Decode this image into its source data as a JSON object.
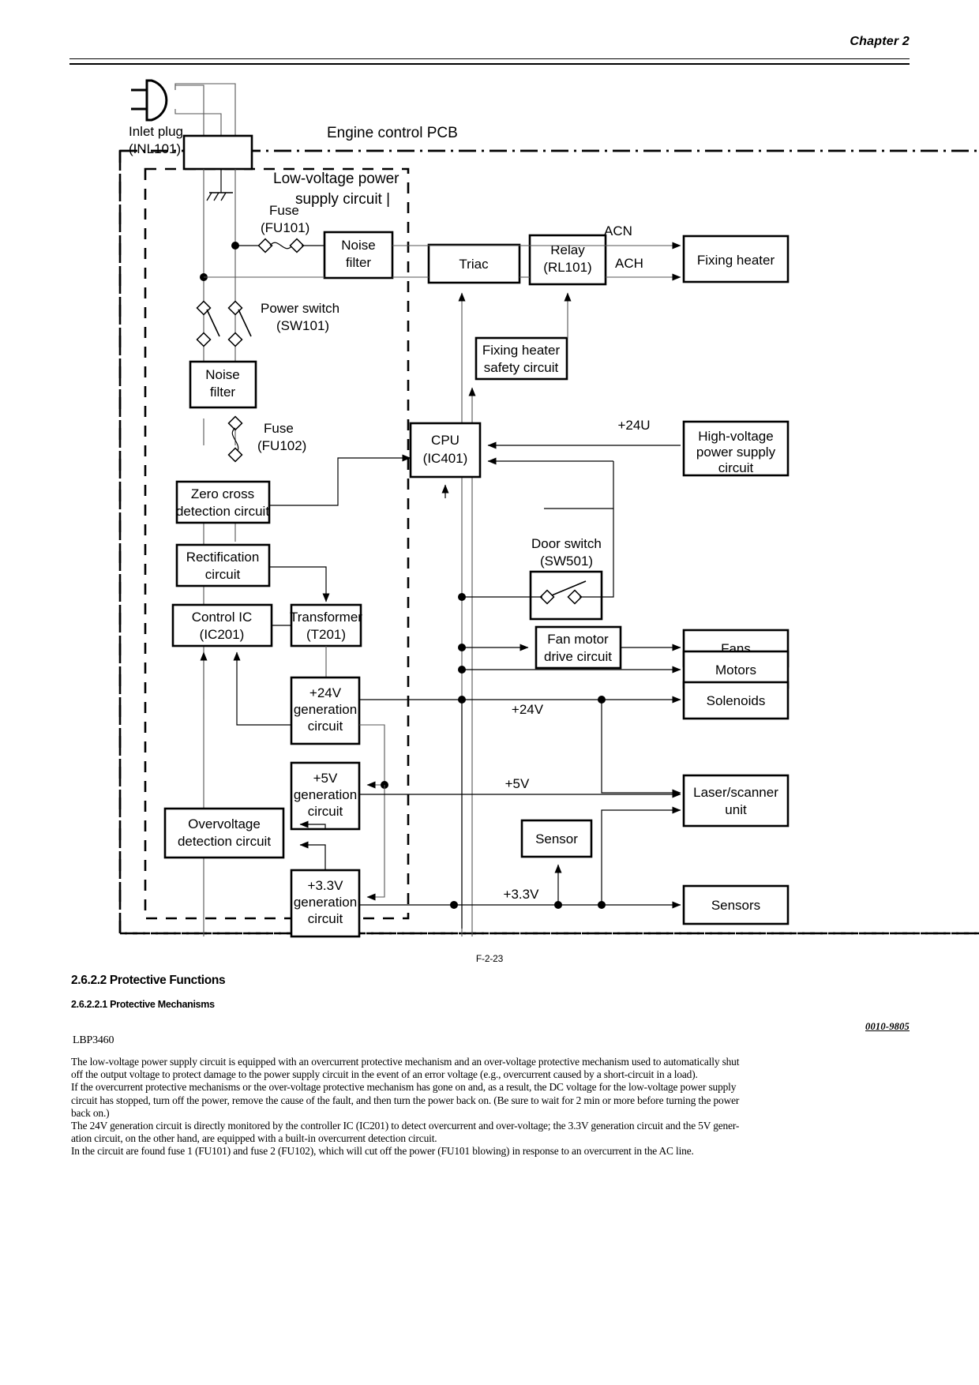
{
  "header": {
    "chapter": "Chapter 2"
  },
  "figure": {
    "caption": "F-2-23",
    "title_engine_pcb": "Engine control PCB",
    "title_lvps_line1": "Low-voltage power",
    "title_lvps_line2": "supply circuit |",
    "inlet_plug_line1": "Inlet plug",
    "inlet_plug_line2": "(INL101)",
    "fuse1_line1": "Fuse",
    "fuse1_line2": "(FU101)",
    "fuse2_line1": "Fuse",
    "fuse2_line2": "(FU102)",
    "power_switch_line1": "Power switch",
    "power_switch_line2": "(SW101)",
    "door_switch_line1": "Door switch",
    "door_switch_line2": "(SW501)",
    "noise_filter_1_line1": "Noise",
    "noise_filter_1_line2": "filter",
    "noise_filter_2_line1": "Noise",
    "noise_filter_2_line2": "filter",
    "triac": "Triac",
    "relay_line1": "Relay",
    "relay_line2": "(RL101)",
    "fixing_heater_safety_line1": "Fixing heater",
    "fixing_heater_safety_line2": "safety circuit",
    "cpu_line1": "CPU",
    "cpu_line2": "(IC401)",
    "zero_cross_line1": "Zero cross",
    "zero_cross_line2": "detection circuit",
    "rectification_line1": "Rectification",
    "rectification_line2": "circuit",
    "control_ic_line1": "Control IC",
    "control_ic_line2": "(IC201)",
    "transformer_line1": "Transformer",
    "transformer_line2": "(T201)",
    "gen24_line1": "+24V",
    "gen24_line2": "generation",
    "gen24_line3": "circuit",
    "gen5_line1": "+5V",
    "gen5_line2": "generation",
    "gen5_line3": "circuit",
    "gen33_line1": "+3.3V",
    "gen33_line2": "generation",
    "gen33_line3": "circuit",
    "overvoltage_line1": "Overvoltage",
    "overvoltage_line2": "detection circuit",
    "fan_motor_line1": "Fan motor",
    "fan_motor_line2": "drive circuit",
    "sensor_box": "Sensor",
    "fixing_heater": "Fixing heater",
    "hv_psu_line1": "High-voltage",
    "hv_psu_line2": "power supply",
    "hv_psu_line3": "circuit",
    "fans": "Fans",
    "motors": "Motors",
    "solenoids": "Solenoids",
    "laser_scanner_line1": "Laser/scanner",
    "laser_scanner_line2": "unit",
    "sensors": "Sensors",
    "signal_acn": "ACN",
    "signal_ach": "ACH",
    "signal_24u": "+24U",
    "signal_24v": "+24V",
    "signal_5v": "+5V",
    "signal_33v": "+3.3V"
  },
  "sections": {
    "heading_2622": "2.6.2.2 Protective Functions",
    "heading_26221": "2.6.2.2.1 Protective Mechanisms"
  },
  "document": {
    "code": "0010-9805",
    "model": "LBP3460"
  },
  "body": {
    "text": "The low-voltage power supply circuit is equipped with an overcurrent protective mechanism and an over-voltage protective mechanism used to automatically shut\noff the output voltage to protect damage to the power supply circuit in the event of an error voltage (e.g., overcurrent caused by a short-circuit in a load).\nIf the overcurrent protective mechanisms or the over-voltage protective mechanism has gone on and, as a result, the DC voltage for the low-voltage power supply\ncircuit has stopped, turn off the power, remove the cause of the fault, and then turn the power back on. (Be sure to wait for 2 min or more before turning the power\nback on.)\nThe 24V generation circuit is directly monitored by the controller IC (IC201) to detect overcurrent and over-voltage; the 3.3V generation circuit and the 5V gener-\nation circuit, on the other hand, are equipped with a built-in overcurrent detection circuit.\nIn the circuit are found fuse 1 (FU101) and fuse 2 (FU102), which will cut off the power (FU101 blowing) in response to an overcurrent in the AC line."
  }
}
